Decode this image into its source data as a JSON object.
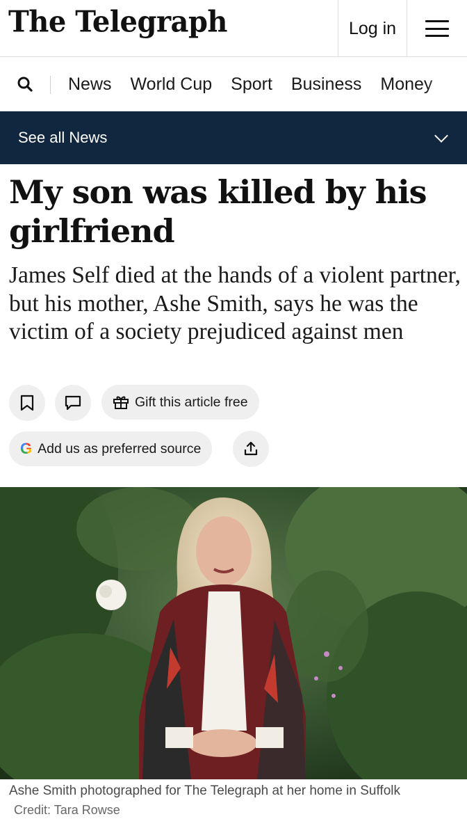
{
  "header": {
    "logo_text": "The Telegraph",
    "login_label": "Log in"
  },
  "nav": {
    "items": [
      "News",
      "World Cup",
      "Sport",
      "Business",
      "Money"
    ]
  },
  "section": {
    "label": "See all News"
  },
  "article": {
    "headline": "My son was killed by his girlfriend",
    "standfirst": "James Self died at the hands of a violent partner, but his mother, Ashe Smith, says he was the victim of a society prejudiced against men",
    "gift_label": "Gift this article free",
    "preferred_source_label": "Add us as preferred source",
    "google_glyph": "G",
    "image_caption": "Ashe Smith photographed for The Telegraph at her home in Suffolk",
    "image_credit": "Credit: Tara Rowse"
  },
  "colors": {
    "section_bar": "#10273f",
    "button_bg": "#efefef"
  },
  "icons": [
    "search-icon",
    "chevron-down-icon",
    "menu-icon",
    "bookmark-icon",
    "comment-icon",
    "gift-icon",
    "google-icon",
    "share-icon"
  ]
}
